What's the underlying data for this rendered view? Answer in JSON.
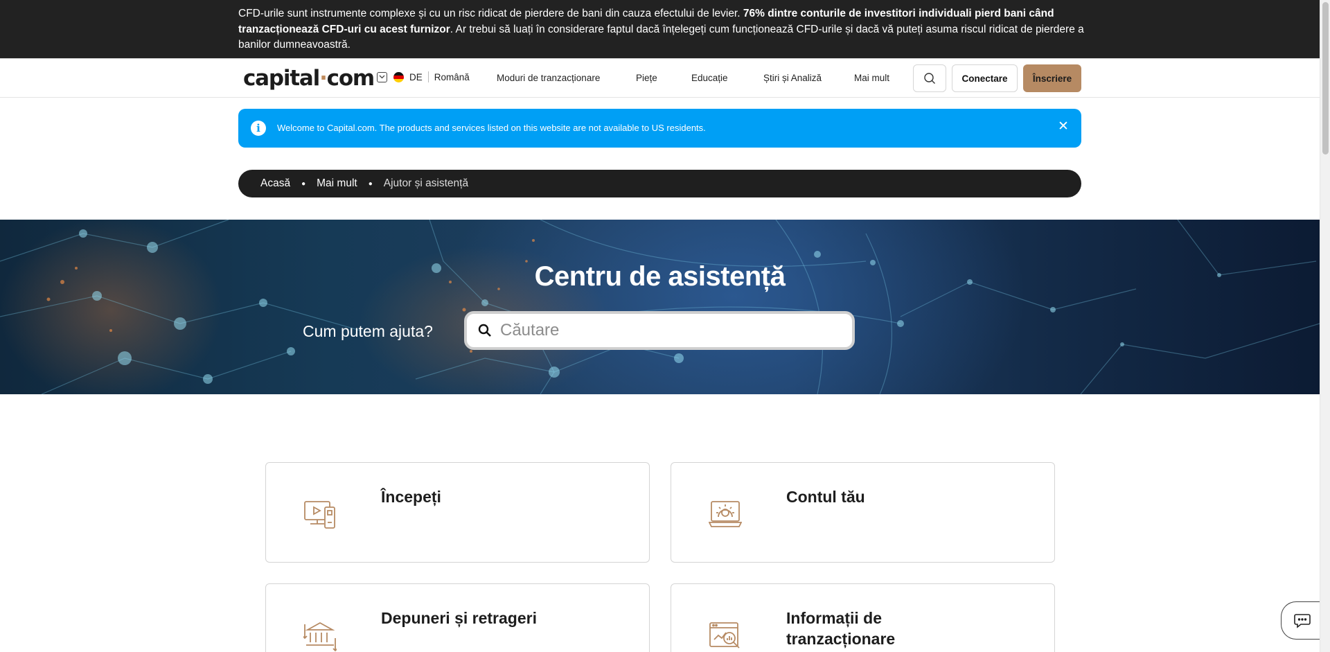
{
  "risk_banner": {
    "text_1": "CFD-urile sunt instrumente complexe și cu un risc ridicat de pierdere de bani din cauza efectului de levier. ",
    "text_bold": "76% dintre conturile de investitori individuali pierd bani când tranzacționează CFD-uri cu acest furnizor",
    "text_2": ". Ar trebui să luați în considerare faptul dacă înțelegeți cum funcționează CFD-urile și dacă vă puteți asuma riscul ridicat de pierdere a banilor dumneavoastră."
  },
  "header": {
    "logo_left": "capital",
    "logo_dot": "·",
    "logo_right": "com",
    "country_code": "DE",
    "language": "Română",
    "nav": [
      "Moduri de tranzacționare",
      "Piețe",
      "Educație",
      "Știri și Analiză",
      "Mai mult"
    ],
    "login_label": "Conectare",
    "signup_label": "Înscriere",
    "brand_color": "#b68a63"
  },
  "info_banner": {
    "message": "Welcome to Capital.com. The products and services listed on this website are not available to US residents.",
    "close": "✕",
    "color": "#009ff5"
  },
  "breadcrumb": [
    "Acasă",
    "Mai mult",
    "Ajutor și asistență"
  ],
  "hero": {
    "title": "Centru de asistență",
    "prompt": "Cum putem ajuta?",
    "search_placeholder": "Căutare"
  },
  "categories": [
    {
      "title": "Începeți",
      "icon": "video-tutorial-icon"
    },
    {
      "title": "Contul tău",
      "icon": "account-settings-icon"
    },
    {
      "title": "Depuneri și retrageri",
      "icon": "bank-transfer-icon"
    },
    {
      "title": "Informații de tranzacționare",
      "icon": "trading-chart-icon"
    }
  ]
}
